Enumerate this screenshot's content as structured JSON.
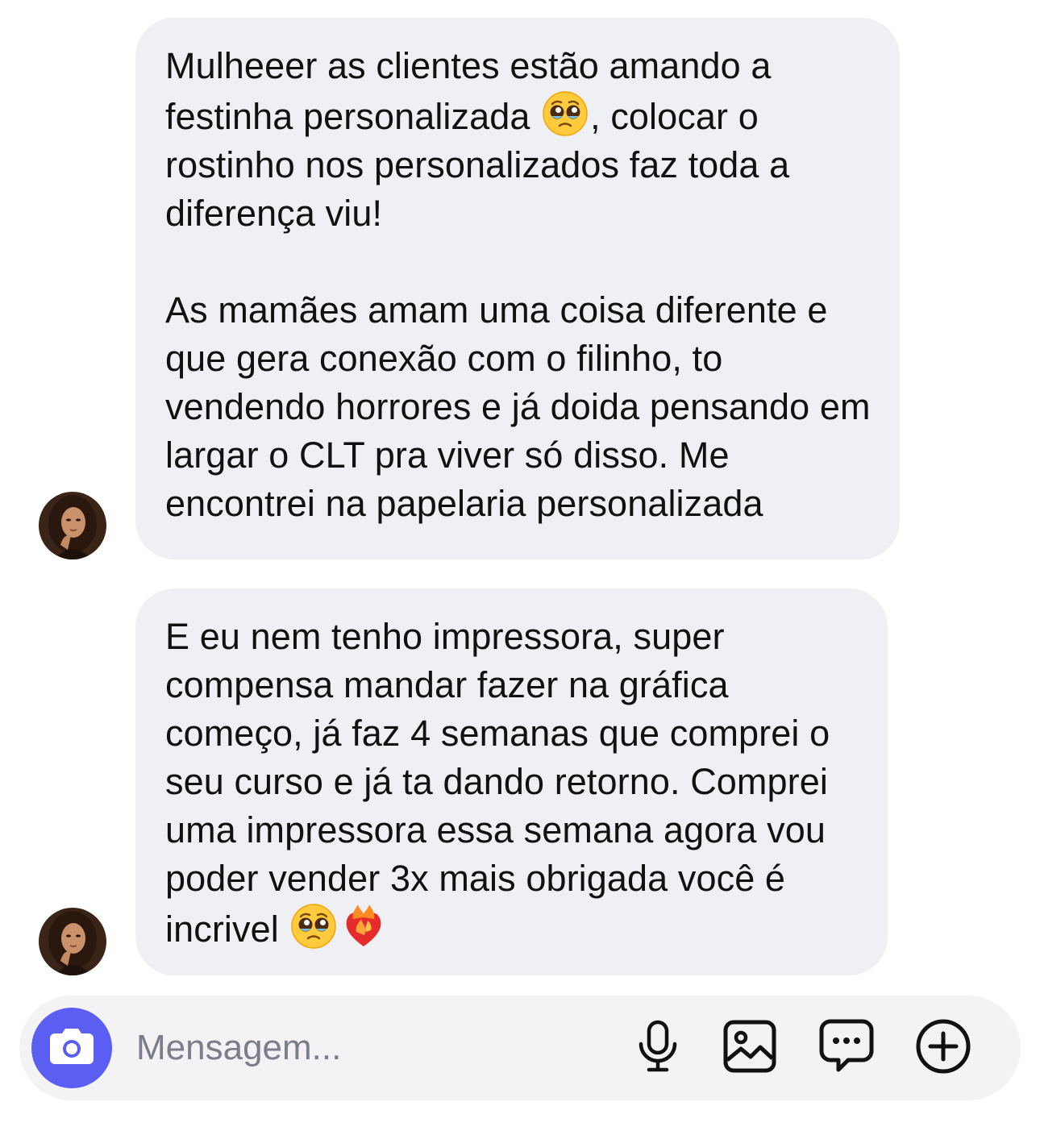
{
  "messages": [
    {
      "sender": "contact",
      "paragraphs": [
        {
          "before_emoji": "Mulheeer as clientes estão amando a festinha personalizada ",
          "emoji_icon": "pleading-face-icon",
          "after_emoji": ", colocar o rostinho nos personalizados faz toda a diferença viu!"
        },
        {
          "text": "As mamães amam uma coisa diferente e que gera conexão com o filinho, to vendendo horrores e já doida pensando em largar o CLT pra viver só disso. Me encontrei na papelaria personalizada"
        }
      ]
    },
    {
      "sender": "contact",
      "paragraphs": [
        {
          "before_emoji": "E eu nem tenho impressora, super compensa mandar fazer na gráfica começo, já faz 4 semanas que comprei o seu curso e já ta dando retorno. Comprei uma impressora essa semana agora vou poder vender 3x mais obrigada você é incrivel ",
          "emoji_icons": [
            "pleading-face-icon",
            "heart-on-fire-icon"
          ]
        }
      ]
    }
  ],
  "composer": {
    "placeholder": "Mensagem...",
    "icons": [
      "camera-icon",
      "microphone-icon",
      "image-icon",
      "chat-bubble-icon",
      "plus-circle-icon"
    ]
  },
  "colors": {
    "bubble_background": "#eff0f4",
    "composer_background": "#f3f3f6",
    "camera_button": "#5b5ef3",
    "placeholder_text": "#7b7e88"
  }
}
